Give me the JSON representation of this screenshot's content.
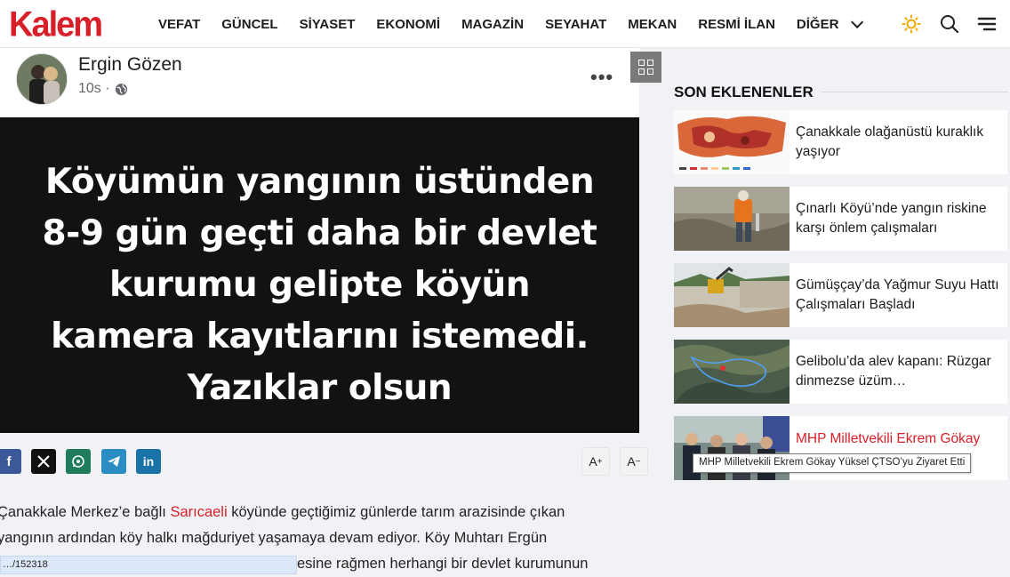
{
  "header": {
    "logo_text": "Kalem",
    "nav": [
      "VEFAT",
      "GÜNCEL",
      "SİYASET",
      "EKONOMİ",
      "MAGAZİN",
      "SEYAHAT",
      "MEKAN",
      "RESMİ İLAN"
    ],
    "more_label": "DİĞER",
    "icons": [
      "sun-icon",
      "search-icon",
      "menu-icon"
    ]
  },
  "post": {
    "author": "Ergin Gözen",
    "time": "10s ·",
    "quote": "Köyümün yangının üstünden 8-9 gün geçti daha bir devlet kurumu gelipte köyün kamera kayıtlarını istemedi. Yazıklar olsun"
  },
  "share": {
    "icons": [
      "facebook-icon",
      "x-icon",
      "whatsapp-icon",
      "telegram-icon",
      "linkedin-icon"
    ],
    "font_increase": "A",
    "font_decrease": "A"
  },
  "article": {
    "line1_pre": "Çanakkale Merkez’e bağlı ",
    "line1_link": "Sarıcaeli",
    "line1_post": " köyünde geçtiğimiz günlerde tarım arazisinde çıkan",
    "line2": "yangının ardından köy halkı mağduriyet yaşamaya devam ediyor. Köy Muhtarı Ergün",
    "line3_visible": "esine rağmen herhangi bir devlet kurumunun"
  },
  "status_url": "…/152318",
  "sidebar": {
    "title": "SON EKLENENLER",
    "items": [
      {
        "title": "Çanakkale olağanüstü kuraklık yaşıyor"
      },
      {
        "title": "Çınarlı Köyü’nde yangın riskine karşı önlem çalışmaları"
      },
      {
        "title": "Gümüşçay’da Yağmur Suyu Hattı Çalışmaları Başladı"
      },
      {
        "title": "Gelibolu’da alev kapanı: Rüzgar dinmezse üzüm…"
      },
      {
        "title": "MHP Milletvekili Ekrem Gökay"
      }
    ],
    "tooltip": "MHP Milletvekili Ekrem Gökay Yüksel ÇTSO’yu Ziyaret Etti"
  },
  "colors": {
    "brand": "#d8202a",
    "facebook": "#3b5998",
    "x": "#111111",
    "whatsapp": "#1e7c5a",
    "telegram": "#2b8cc4",
    "linkedin": "#1a73a8"
  }
}
